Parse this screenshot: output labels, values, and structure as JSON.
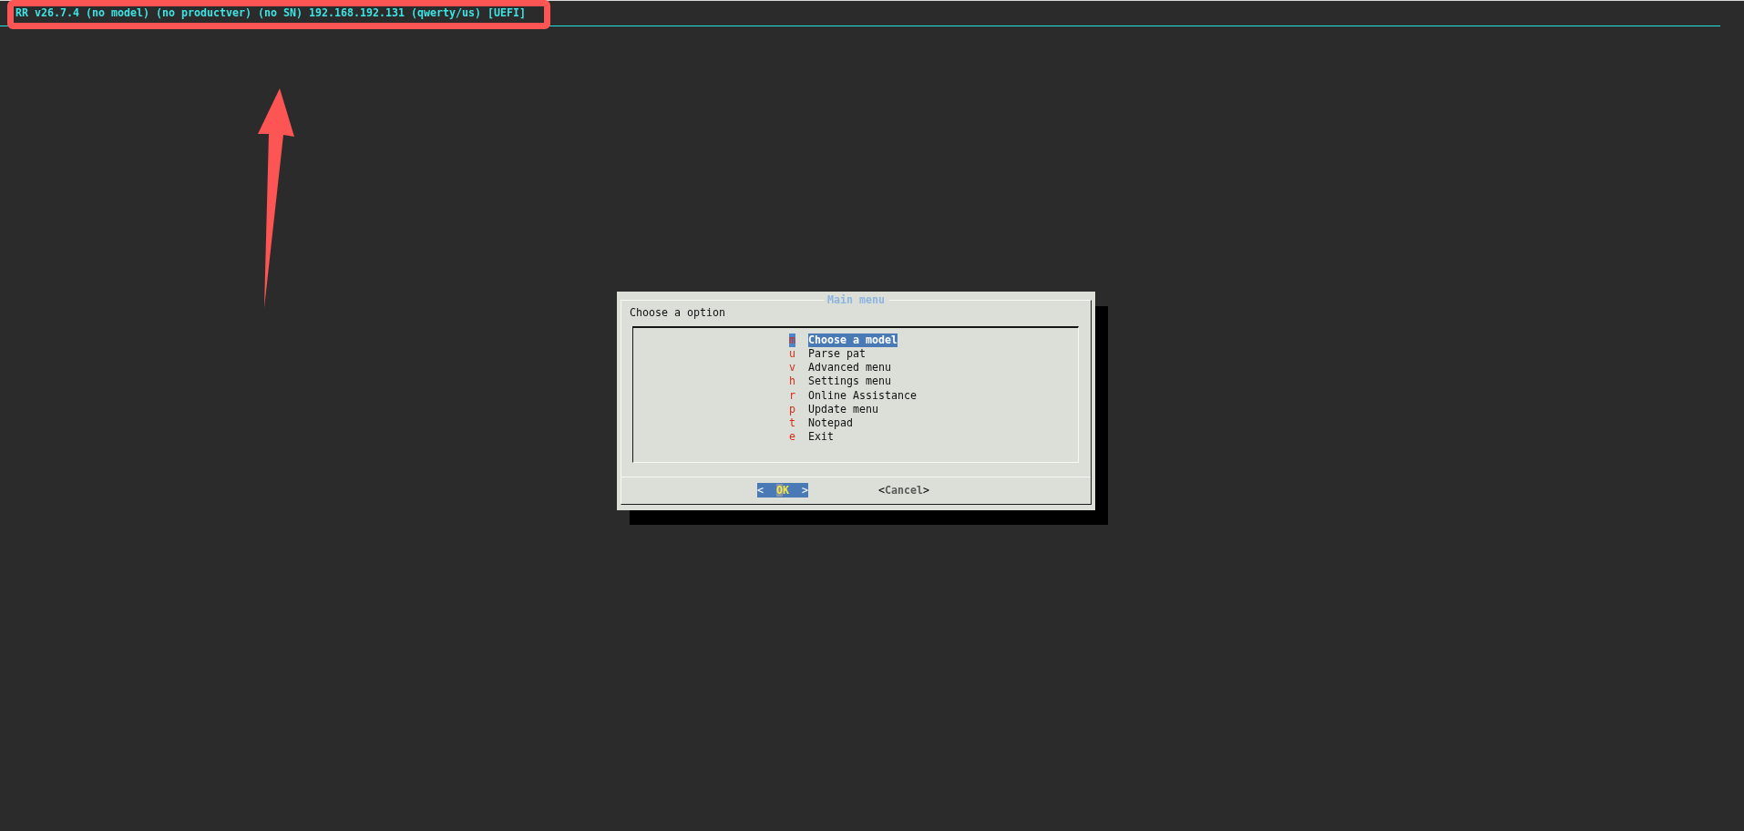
{
  "backtitle": "RR v26.7.4 (no model) (no productver) (no SN) 192.168.192.131 (qwerty/us) [UEFI]",
  "dialog": {
    "title": "Main menu",
    "prompt": "Choose a option",
    "menu_items": [
      {
        "tag": "m",
        "label": "Choose a model",
        "selected": true
      },
      {
        "tag": "u",
        "label": "Parse pat",
        "selected": false
      },
      {
        "tag": "v",
        "label": "Advanced menu",
        "selected": false
      },
      {
        "tag": "h",
        "label": "Settings menu",
        "selected": false
      },
      {
        "tag": "r",
        "label": "Online Assistance",
        "selected": false
      },
      {
        "tag": "p",
        "label": "Update menu",
        "selected": false
      },
      {
        "tag": "t",
        "label": "Notepad",
        "selected": false
      },
      {
        "tag": "e",
        "label": "Exit",
        "selected": false
      }
    ],
    "buttons": [
      {
        "open": "<",
        "label": "OK",
        "close": ">",
        "selected": true
      },
      {
        "open": "<",
        "label": "Cancel",
        "close": ">",
        "selected": false
      }
    ]
  }
}
